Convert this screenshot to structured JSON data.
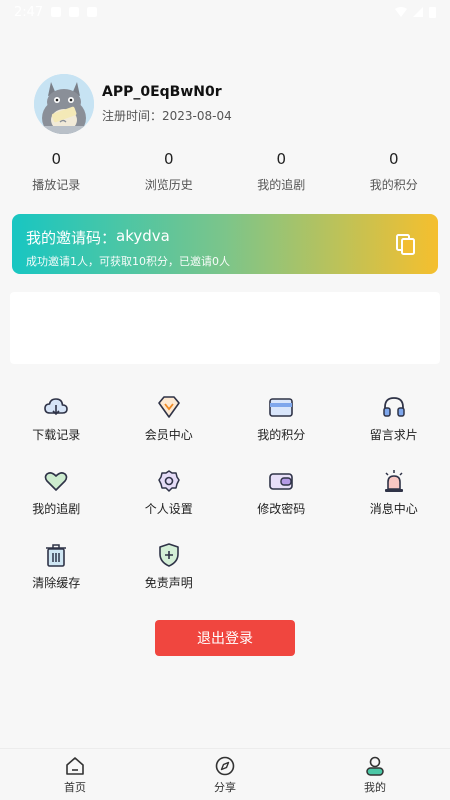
{
  "status_bar": {
    "time": "2:47"
  },
  "profile": {
    "username": "APP_0EqBwN0r",
    "reg_time": "注册时间：2023-08-04"
  },
  "stats": [
    {
      "value": "0",
      "label": "播放记录"
    },
    {
      "value": "0",
      "label": "浏览历史"
    },
    {
      "value": "0",
      "label": "我的追剧"
    },
    {
      "value": "0",
      "label": "我的积分"
    }
  ],
  "invite": {
    "title_prefix": "我的邀请码：",
    "code": "akydva",
    "subtitle": "成功邀请1人，可获取10积分，已邀请0人"
  },
  "menu": [
    {
      "label": "下载记录",
      "icon": "cloud-download-icon"
    },
    {
      "label": "会员中心",
      "icon": "vip-diamond-icon"
    },
    {
      "label": "我的积分",
      "icon": "wallet-card-icon"
    },
    {
      "label": "留言求片",
      "icon": "headphones-icon"
    },
    {
      "label": "我的追剧",
      "icon": "heart-icon"
    },
    {
      "label": "个人设置",
      "icon": "gear-icon"
    },
    {
      "label": "修改密码",
      "icon": "wallet-lock-icon"
    },
    {
      "label": "消息中心",
      "icon": "alarm-bell-icon"
    },
    {
      "label": "清除缓存",
      "icon": "trash-icon"
    },
    {
      "label": "免责声明",
      "icon": "shield-plus-icon"
    }
  ],
  "logout_label": "退出登录",
  "nav": [
    {
      "label": "首页",
      "icon": "home-icon"
    },
    {
      "label": "分享",
      "icon": "compass-icon"
    },
    {
      "label": "我的",
      "icon": "user-icon"
    }
  ]
}
